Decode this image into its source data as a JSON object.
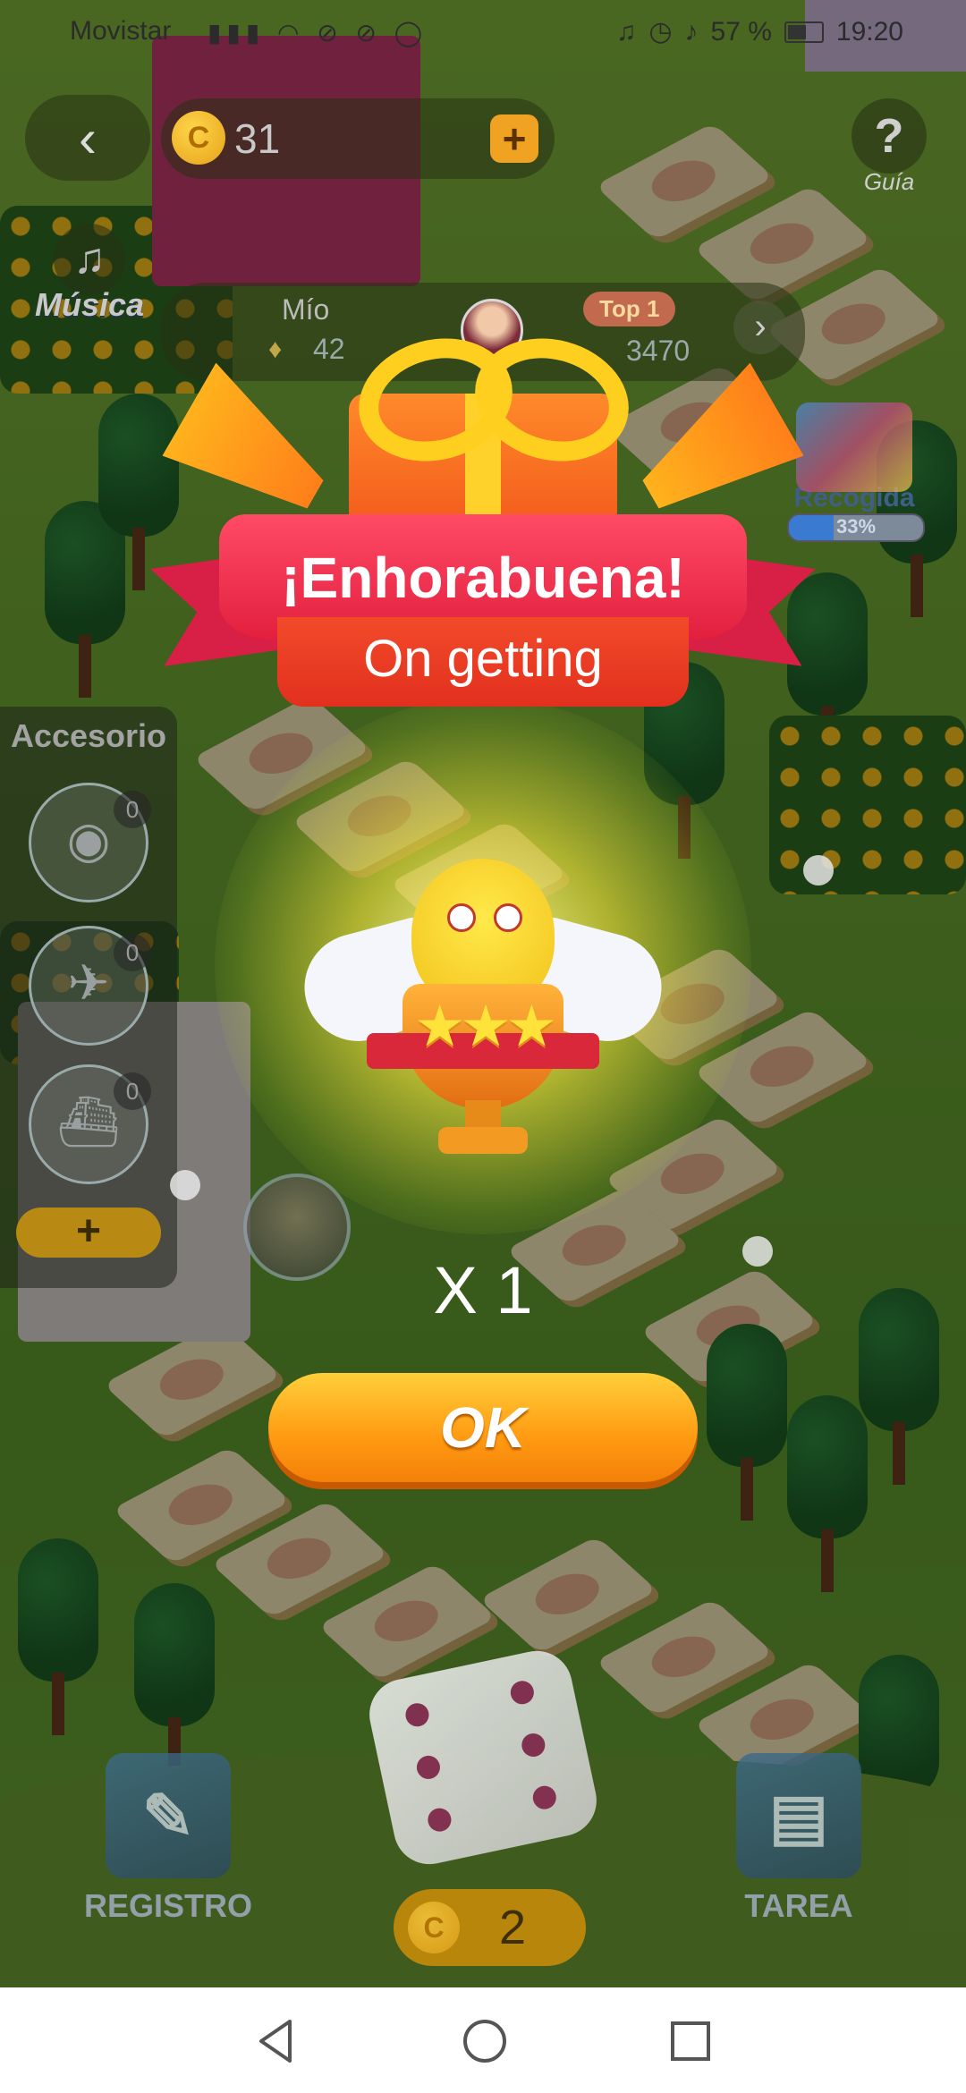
{
  "status_bar": {
    "carrier": "Movistar",
    "battery": "57 %",
    "time": "19:20"
  },
  "top_bar": {
    "coins": "31",
    "add_label": "+",
    "help_symbol": "?",
    "help_label": "Guía",
    "music_label": "Música"
  },
  "ranking": {
    "mine_label": "Mío",
    "mine_value": "42",
    "top_label": "Top 1",
    "top_value": "3470"
  },
  "collection": {
    "label": "Recogida",
    "progress": "33%",
    "progress_fraction": 0.33
  },
  "accessory": {
    "title": "Accesorio",
    "items": [
      {
        "icon": "balloon-icon",
        "count": "0"
      },
      {
        "icon": "plane-icon",
        "count": "0"
      },
      {
        "icon": "ship-icon",
        "count": "0"
      }
    ],
    "add_label": "+"
  },
  "bottom": {
    "registro_label": "REGISTRO",
    "tarea_label": "TAREA",
    "dice_cost": "2"
  },
  "modal": {
    "title": "¡Enhorabuena!",
    "subtitle": "On getting",
    "quantity": "X 1",
    "ok_label": "OK"
  },
  "colors": {
    "banner_red": "#e2203e",
    "ok_orange": "#ff9a12"
  }
}
